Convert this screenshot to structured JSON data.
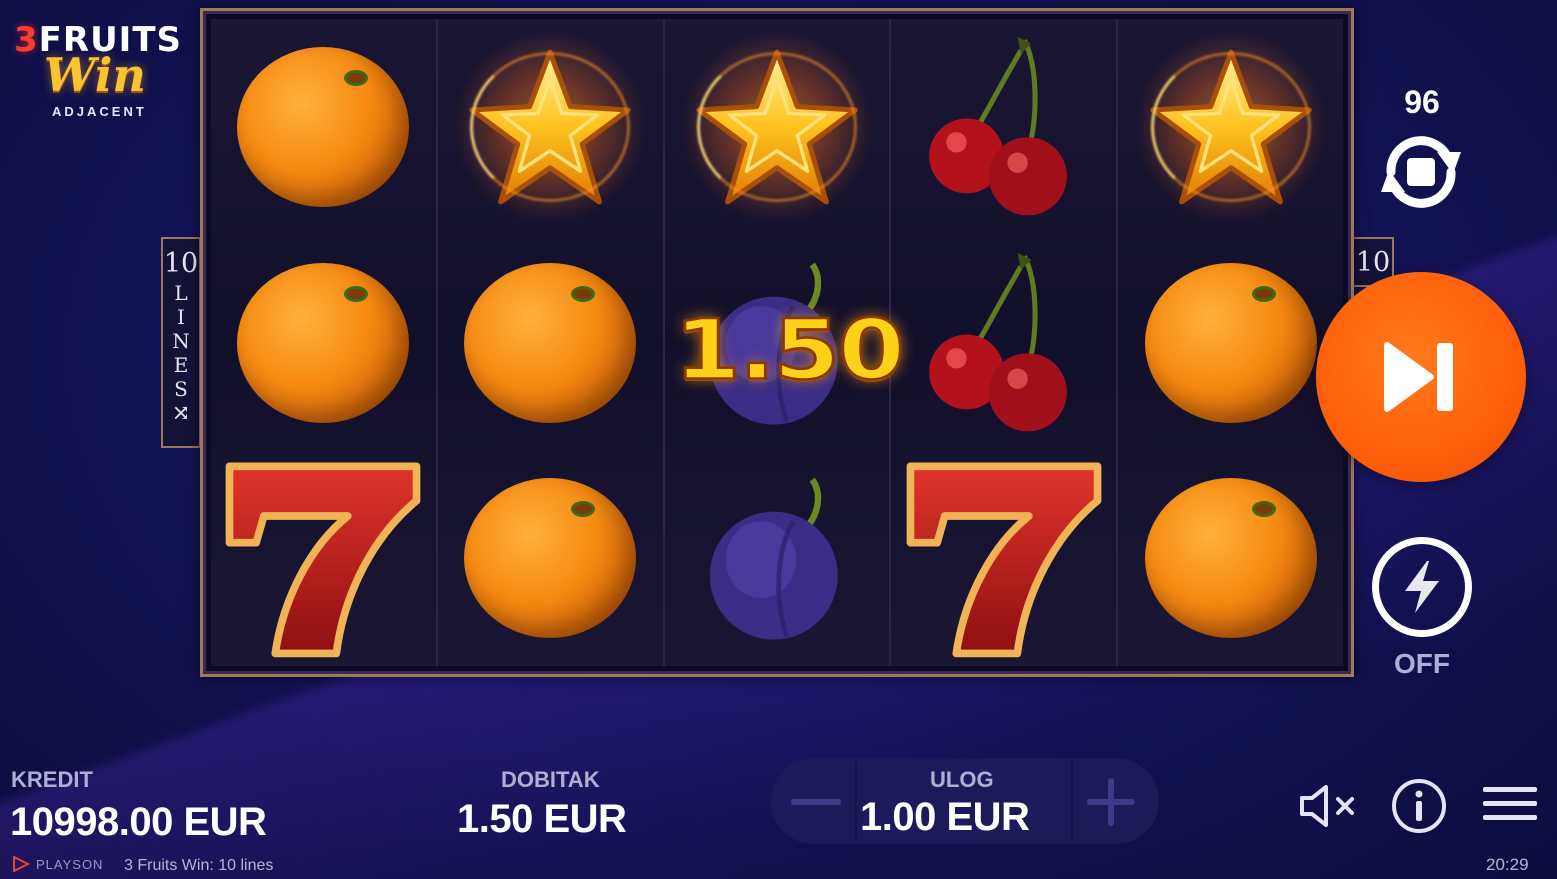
{
  "logo": {
    "number": "3",
    "word1": "FRUITS",
    "word2": "Win",
    "subtitle": "ADJACENT"
  },
  "reels": [
    [
      "orange",
      "orange",
      "seven"
    ],
    [
      "star",
      "orange",
      "orange"
    ],
    [
      "star",
      "plum",
      "plum"
    ],
    [
      "cherry",
      "cherry",
      "seven"
    ],
    [
      "star",
      "orange",
      "orange"
    ]
  ],
  "win_overlay": "1.50",
  "lines": {
    "count": "10",
    "letters": [
      "L",
      "I",
      "N",
      "E",
      "S"
    ],
    "shuffle_glyph": "⤨"
  },
  "autoplay": {
    "count": "96"
  },
  "turbo": {
    "state": "OFF"
  },
  "stats": {
    "credit_label": "KREDIT",
    "credit_value": "10998.00 EUR",
    "win_label": "DOBITAK",
    "win_value": "1.50 EUR",
    "bet_label": "ULOG",
    "bet_value": "1.00 EUR"
  },
  "footer": {
    "brand": "PLAYSON",
    "game_title": "3 Fruits Win: 10 lines",
    "time": "20:29"
  },
  "colors": {
    "spin_button": "#ff5f0a",
    "background": "#14135a",
    "frame_border": "#9a7a5a"
  }
}
